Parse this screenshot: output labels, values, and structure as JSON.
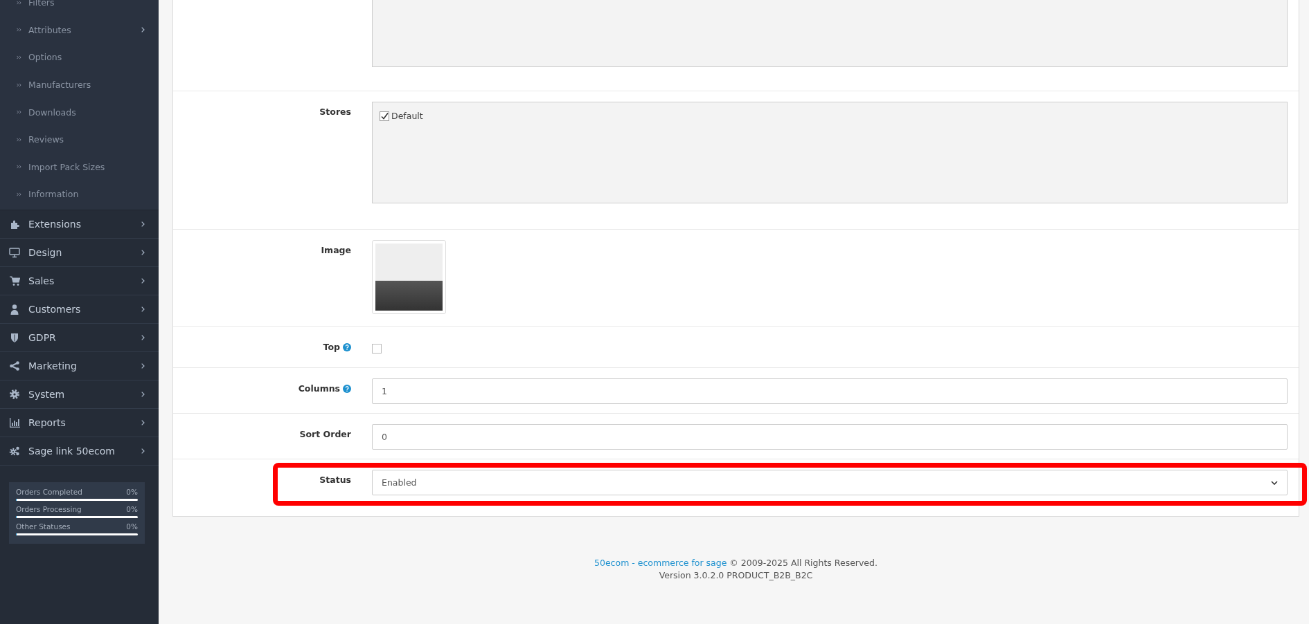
{
  "sidebar": {
    "sub_items": [
      {
        "label": "Filters",
        "has_arrow": false
      },
      {
        "label": "Attributes",
        "has_arrow": true
      },
      {
        "label": "Options",
        "has_arrow": false
      },
      {
        "label": "Manufacturers",
        "has_arrow": false
      },
      {
        "label": "Downloads",
        "has_arrow": false
      },
      {
        "label": "Reviews",
        "has_arrow": false
      },
      {
        "label": "Import Pack Sizes",
        "has_arrow": false
      },
      {
        "label": "Information",
        "has_arrow": false
      }
    ],
    "items": [
      {
        "label": "Extensions"
      },
      {
        "label": "Design"
      },
      {
        "label": "Sales"
      },
      {
        "label": "Customers"
      },
      {
        "label": "GDPR"
      },
      {
        "label": "Marketing"
      },
      {
        "label": "System"
      },
      {
        "label": "Reports"
      },
      {
        "label": "Sage link 50ecom"
      }
    ],
    "stats": [
      {
        "label": "Orders Completed",
        "reading": "0%",
        "level": 0
      },
      {
        "label": "Orders Processing",
        "reading": "0%",
        "level": 0
      },
      {
        "label": "Other Statuses",
        "reading": "0%",
        "level": 0
      }
    ]
  },
  "form": {
    "rows": [
      {
        "kind": "textarea",
        "highlighted": false
      },
      {
        "kind": "checkbox_list",
        "label": "Stores",
        "highlighted": false,
        "options": [
          {
            "label": "Default",
            "checked": true
          }
        ]
      },
      {
        "kind": "image",
        "label": "Image",
        "highlighted": false
      },
      {
        "kind": "checkbox",
        "label": "Top",
        "help": true,
        "checked": false,
        "highlighted": false
      },
      {
        "kind": "input",
        "label": "Columns",
        "help": true,
        "value": "1",
        "highlighted": false
      },
      {
        "kind": "input",
        "label": "Sort Order",
        "help": false,
        "value": "0",
        "highlighted": false
      },
      {
        "kind": "select",
        "label": "Status",
        "value": "Enabled",
        "highlighted": true
      }
    ]
  },
  "footer": {
    "link": "50ecom - ecommerce for sage",
    "text": " © 2009-2025 All Rights Reserved.",
    "version": "Version 3.0.2.0 PRODUCT_B2B_B2C"
  }
}
